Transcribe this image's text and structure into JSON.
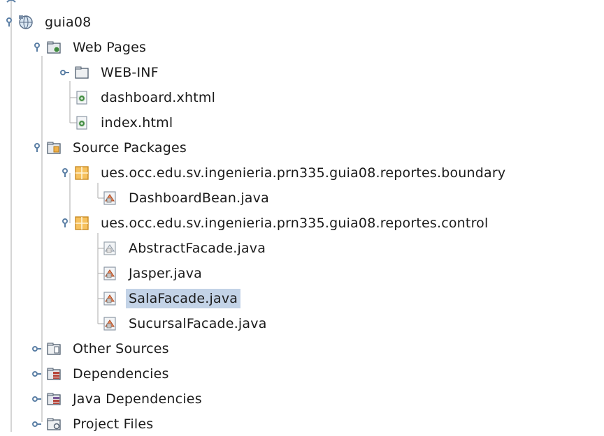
{
  "project_tree": {
    "root": {
      "label": "guia08",
      "icon": "web-project-icon",
      "expanded": true
    },
    "web_pages": {
      "label": "Web Pages",
      "icon": "web-pages-folder-icon",
      "expanded": true,
      "items": [
        {
          "label": "WEB-INF",
          "icon": "folder-icon",
          "expanded": false
        },
        {
          "label": "dashboard.xhtml",
          "icon": "web-file-icon"
        },
        {
          "label": "index.html",
          "icon": "web-file-icon"
        }
      ]
    },
    "source_packages": {
      "label": "Source Packages",
      "icon": "source-packages-icon",
      "expanded": true,
      "packages": [
        {
          "label": "ues.occ.edu.sv.ingenieria.prn335.guia08.reportes.boundary",
          "icon": "package-icon",
          "expanded": true,
          "files": [
            {
              "label": "DashboardBean.java",
              "icon": "java-class-icon"
            }
          ]
        },
        {
          "label": "ues.occ.edu.sv.ingenieria.prn335.guia08.reportes.control",
          "icon": "package-icon",
          "expanded": true,
          "files": [
            {
              "label": "AbstractFacade.java",
              "icon": "java-abstract-class-icon"
            },
            {
              "label": "Jasper.java",
              "icon": "java-class-icon"
            },
            {
              "label": "SalaFacade.java",
              "icon": "java-class-icon",
              "selected": true
            },
            {
              "label": "SucursalFacade.java",
              "icon": "java-class-icon"
            }
          ]
        }
      ]
    },
    "other_nodes": [
      {
        "label": "Other Sources",
        "icon": "other-sources-icon",
        "expanded": false
      },
      {
        "label": "Dependencies",
        "icon": "dependencies-icon",
        "expanded": false
      },
      {
        "label": "Java Dependencies",
        "icon": "java-dependencies-icon",
        "expanded": false
      },
      {
        "label": "Project Files",
        "icon": "project-files-icon",
        "expanded": false
      }
    ]
  },
  "colors": {
    "selection": "#c3d3e7",
    "tree_line": "#b9b9b9",
    "toggle": "#5b7fa5",
    "package_orange": "#f0b048"
  }
}
